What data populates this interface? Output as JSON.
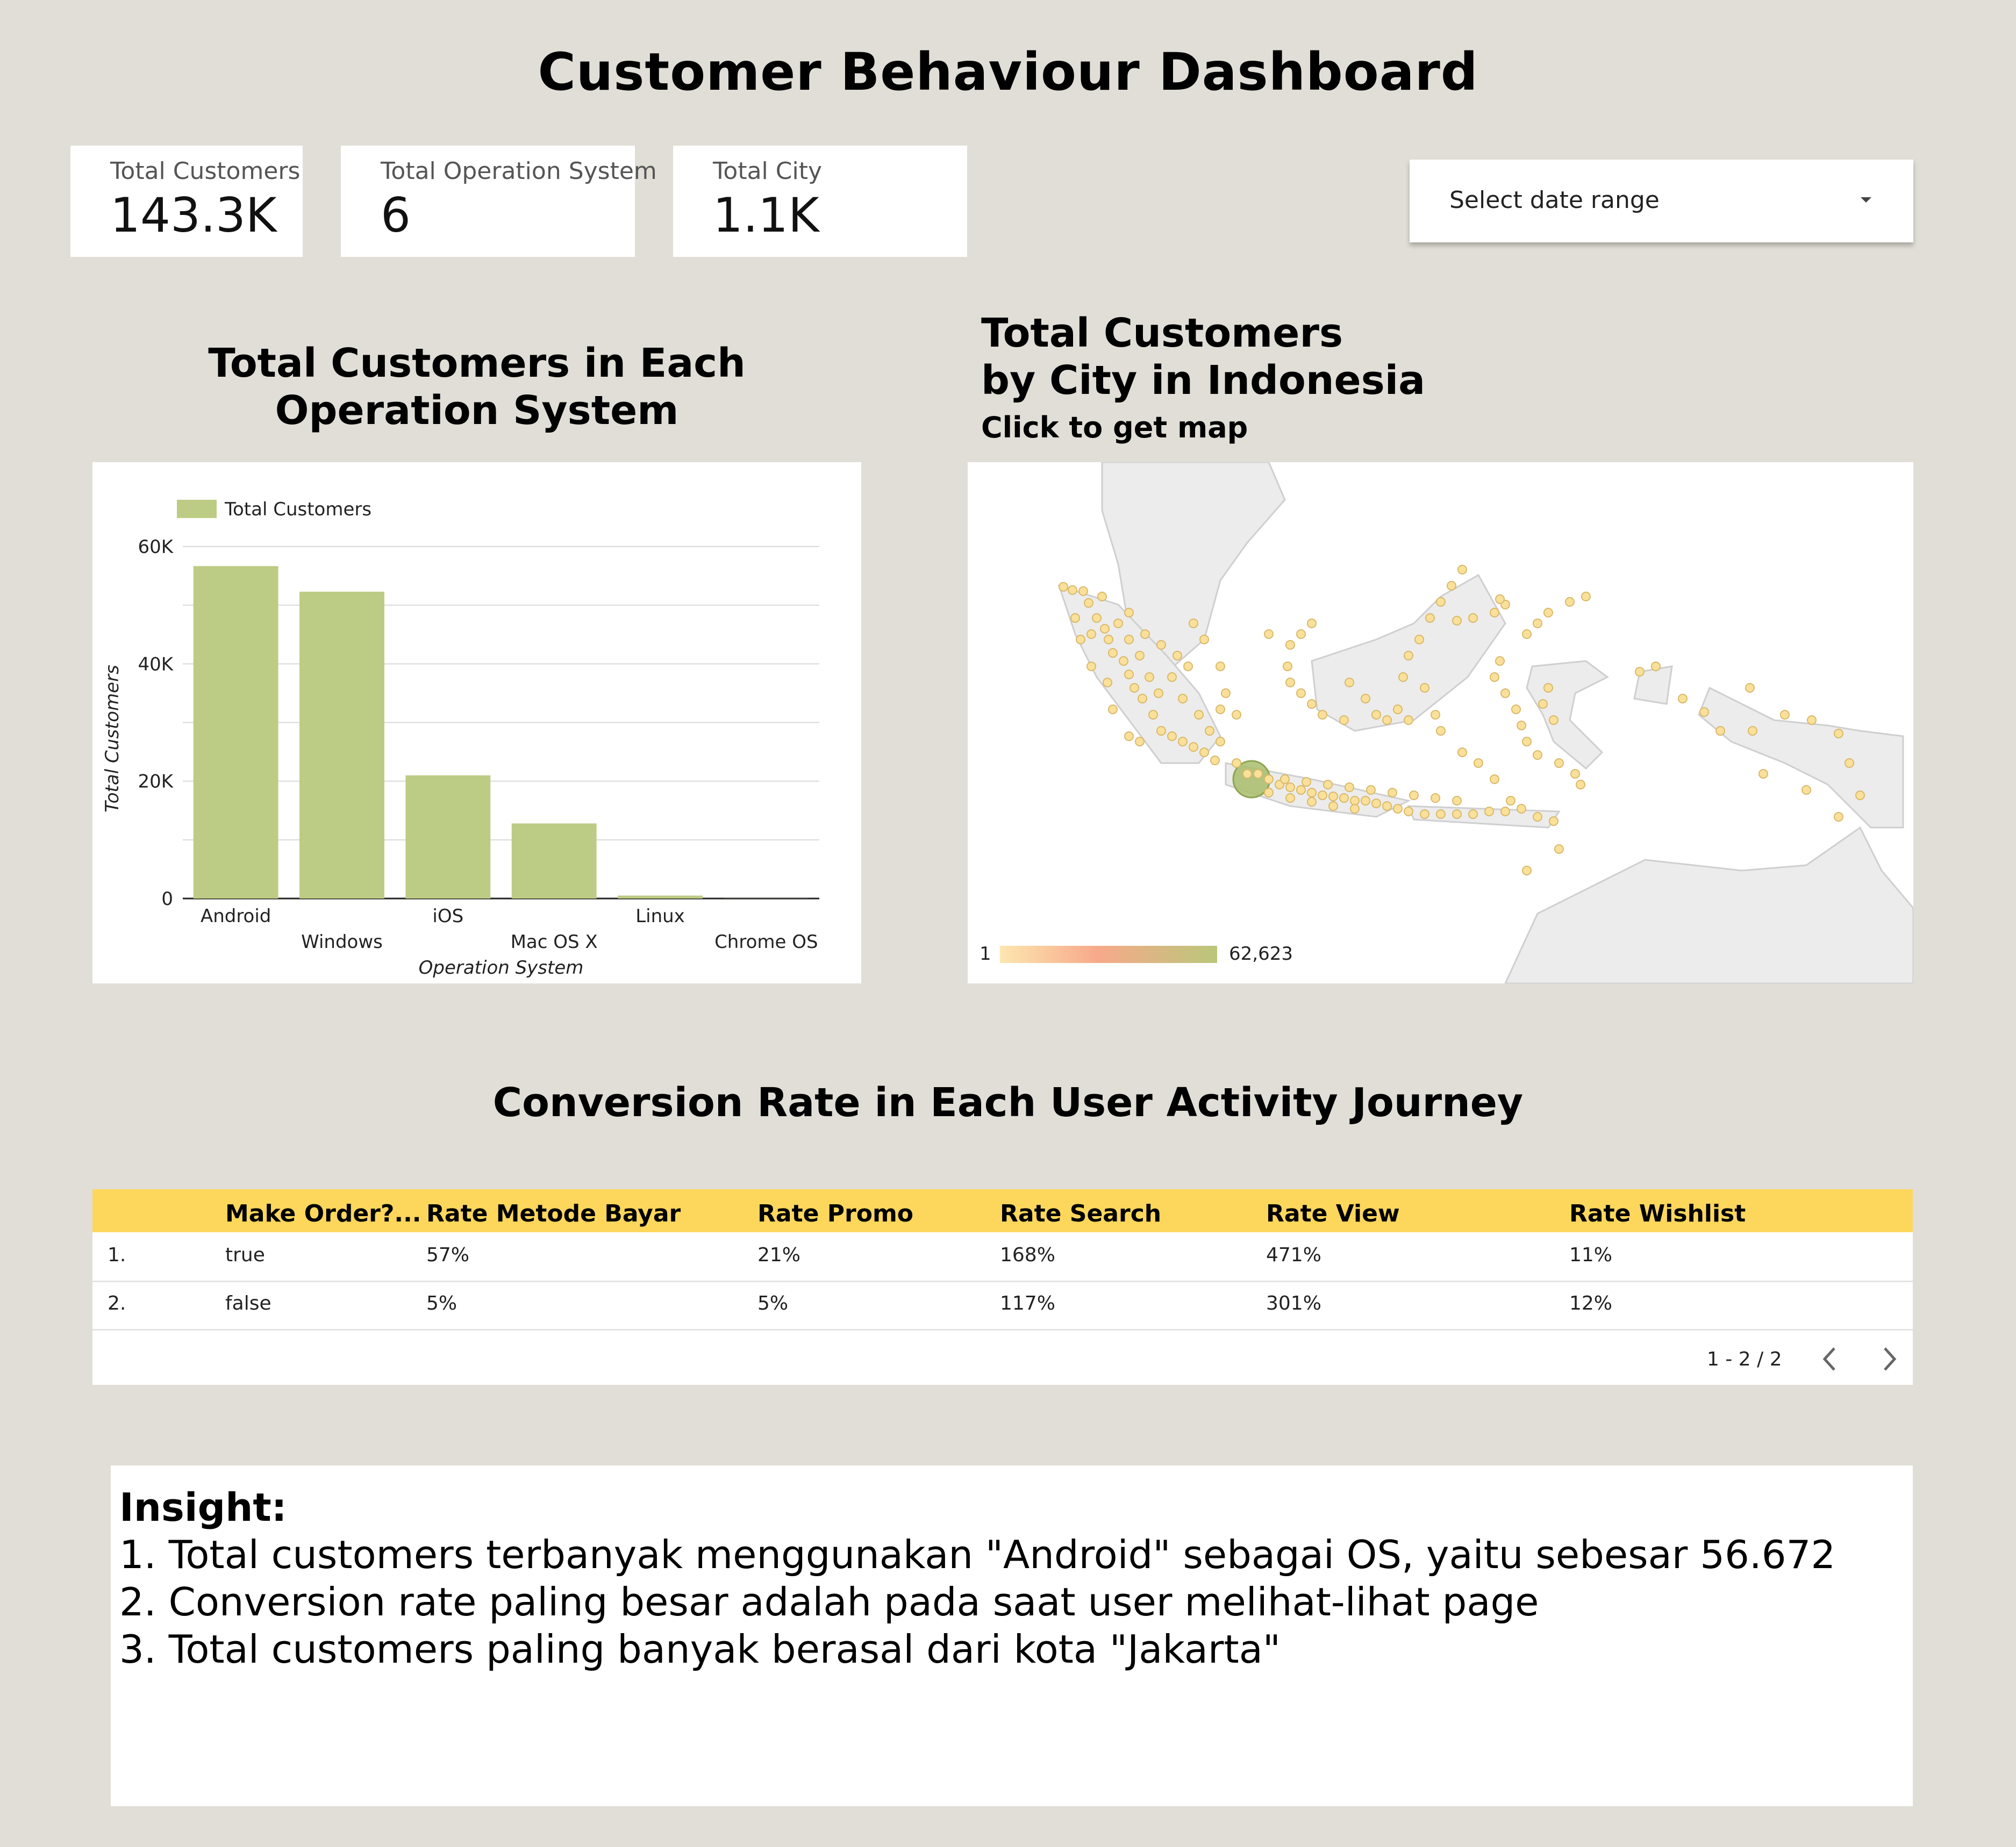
{
  "title": "Customer Behaviour Dashboard",
  "kpis": [
    {
      "label": "Total Customers",
      "value": "143.3K"
    },
    {
      "label": "Total Operation System",
      "value": "6"
    },
    {
      "label": "Total City",
      "value": "1.1K"
    }
  ],
  "date_range": {
    "placeholder": "Select date range"
  },
  "os_chart": {
    "heading_line1": "Total Customers in Each",
    "heading_line2": "Operation System"
  },
  "chart_data": {
    "type": "bar",
    "categories": [
      "Android",
      "Windows",
      "iOS",
      "Mac OS X",
      "Linux",
      "Chrome OS"
    ],
    "series": [
      {
        "name": "Total Customers",
        "values": [
          56672,
          52300,
          21000,
          12800,
          500,
          20
        ],
        "color": "#bccc84"
      }
    ],
    "xlabel": "Operation System",
    "ylabel": "Total Customers",
    "ylim": [
      0,
      60000
    ],
    "yticks": [
      "0",
      "20K",
      "40K",
      "60K"
    ],
    "grid": true,
    "legend": "top-left"
  },
  "map": {
    "heading_line1": "Total Customers",
    "heading_line2": "by City in Indonesia",
    "subheading": "Click to get map",
    "scale_min": "1",
    "scale_max": "62,623",
    "bubble_color": "#fbe09a",
    "highlight_color": "#a8bd6a"
  },
  "conversion": {
    "heading": "Conversion Rate in Each User Activity Journey",
    "columns": [
      "",
      "Make Order?...",
      "Rate Metode Bayar",
      "Rate Promo",
      "Rate Search",
      "Rate View",
      "Rate Wishlist"
    ],
    "rows": [
      [
        "1.",
        "true",
        "57%",
        "21%",
        "168%",
        "471%",
        "11%"
      ],
      [
        "2.",
        "false",
        "5%",
        "5%",
        "117%",
        "301%",
        "12%"
      ]
    ],
    "pagination": "1 - 2 / 2",
    "header_color": "#fdd75c"
  },
  "insight": {
    "heading": "Insight:",
    "lines": [
      "1. Total customers terbanyak menggunakan \"Android\" sebagai OS, yaitu sebesar 56.672",
      "2. Conversion rate paling besar adalah pada saat user melihat-lihat page",
      "3. Total customers paling banyak berasal dari kota \"Jakarta\""
    ]
  }
}
